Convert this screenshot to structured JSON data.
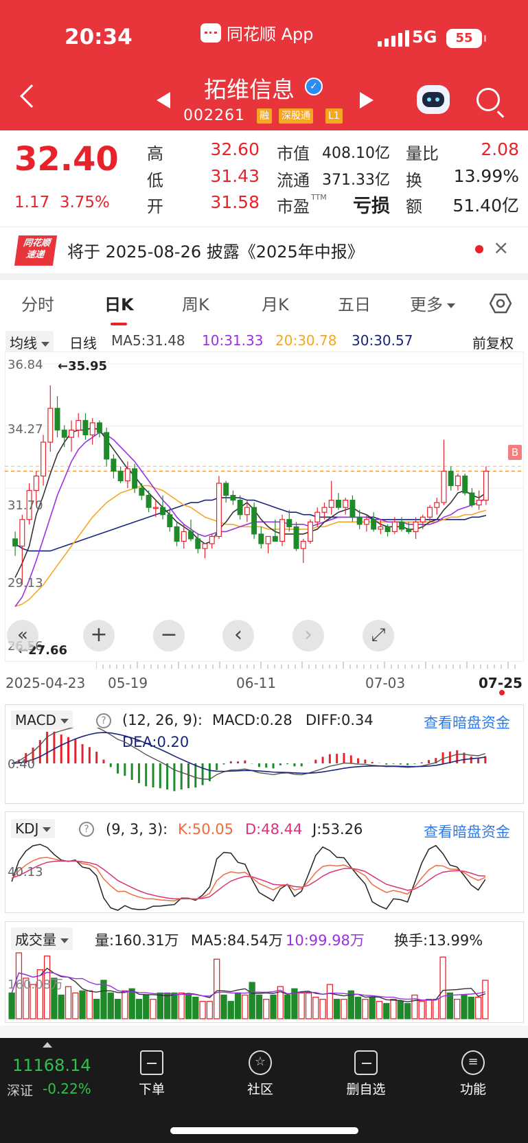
{
  "status_bar": {
    "time": "20:34",
    "app_name": "同花顺 App",
    "network": "5G",
    "battery": "55"
  },
  "header": {
    "stock_name": "拓维信息",
    "stock_code": "002261",
    "badges": [
      "融",
      "深股通",
      "L1"
    ]
  },
  "quote": {
    "price": "32.40",
    "change": "1.17",
    "change_pct": "3.75%",
    "high_label": "高",
    "high": "32.60",
    "low_label": "低",
    "low": "31.43",
    "open_label": "开",
    "open": "31.58",
    "mktcap_label": "市值",
    "mktcap": "408.10亿",
    "float_label": "流通",
    "float": "371.33亿",
    "pe_label": "市盈",
    "pe_sup": "TTM",
    "pe": "亏损",
    "vol_ratio_label": "量比",
    "vol_ratio": "2.08",
    "turnover_label": "换",
    "turnover": "13.99%",
    "amount_label": "额",
    "amount": "51.40亿"
  },
  "notice": {
    "logo_line1": "同花顺",
    "logo_line2": "速递",
    "text": "将于 2025-08-26 披露《2025年中报》",
    "close": "×"
  },
  "tabs": [
    "分时",
    "日K",
    "周K",
    "月K",
    "五日",
    "更多"
  ],
  "ma_bar": {
    "selector": "均线",
    "kline_label": "日线",
    "ma5": "MA5:31.48",
    "ma10": "10:31.33",
    "ma20": "20:30.78",
    "ma30": "30:30.57",
    "adjust": "前复权"
  },
  "colors": {
    "up": "#e8222a",
    "down": "#1f8a2a",
    "ma5": "#333333",
    "ma10": "#9b30e0",
    "ma20": "#f5a623",
    "ma30": "#1a237e"
  },
  "kline": {
    "y_axis": [
      "36.84",
      "34.27",
      "31.70",
      "29.13",
      "26.56"
    ],
    "max_label": "←35.95",
    "min_label": "←27.66",
    "b_marker": "B",
    "dates": [
      "2025-04-23",
      "05-19",
      "06-11",
      "07-03",
      "07-25"
    ],
    "zoom_plus": "+",
    "zoom_minus": "−",
    "nav_prev": "‹",
    "nav_next": "›",
    "fullscreen": "⤢",
    "collapse": "«"
  },
  "chart_data": {
    "type": "candlestick",
    "ylim": [
      26.56,
      36.84
    ],
    "candles": [
      [
        29.6,
        29.9,
        28.9,
        29.3
      ],
      [
        29.3,
        30.6,
        27.7,
        30.4
      ],
      [
        30.4,
        31.9,
        30.2,
        31.6
      ],
      [
        31.6,
        32.4,
        31.0,
        32.2
      ],
      [
        32.2,
        33.9,
        31.8,
        33.6
      ],
      [
        33.6,
        35.95,
        33.2,
        35.0
      ],
      [
        35.0,
        35.5,
        33.8,
        34.1
      ],
      [
        34.1,
        34.3,
        33.4,
        33.8
      ],
      [
        33.8,
        34.5,
        33.2,
        34.1
      ],
      [
        34.1,
        34.8,
        33.8,
        34.5
      ],
      [
        34.5,
        34.8,
        33.7,
        33.9
      ],
      [
        33.9,
        34.6,
        33.5,
        34.4
      ],
      [
        34.4,
        34.5,
        33.8,
        34.0
      ],
      [
        34.0,
        34.2,
        32.6,
        32.9
      ],
      [
        32.9,
        33.1,
        32.1,
        32.4
      ],
      [
        32.4,
        32.6,
        31.9,
        32.0
      ],
      [
        32.0,
        32.8,
        31.7,
        32.5
      ],
      [
        32.5,
        32.7,
        31.5,
        31.7
      ],
      [
        31.7,
        31.9,
        31.2,
        31.4
      ],
      [
        31.4,
        31.6,
        30.7,
        30.9
      ],
      [
        30.9,
        31.2,
        30.5,
        30.9
      ],
      [
        30.9,
        31.4,
        30.4,
        30.6
      ],
      [
        30.6,
        30.9,
        29.9,
        30.1
      ],
      [
        30.1,
        30.3,
        29.3,
        29.5
      ],
      [
        29.5,
        30.2,
        29.2,
        29.9
      ],
      [
        29.9,
        30.4,
        29.5,
        29.6
      ],
      [
        29.6,
        29.8,
        29.0,
        29.2
      ],
      [
        29.2,
        29.4,
        28.8,
        29.4
      ],
      [
        29.4,
        29.8,
        29.2,
        29.7
      ],
      [
        29.7,
        32.2,
        29.6,
        31.9
      ],
      [
        31.9,
        32.0,
        31.1,
        31.4
      ],
      [
        31.4,
        31.6,
        31.0,
        31.2
      ],
      [
        31.2,
        31.4,
        30.4,
        30.6
      ],
      [
        30.6,
        31.2,
        30.3,
        30.9
      ],
      [
        30.9,
        31.1,
        29.6,
        29.8
      ],
      [
        29.8,
        30.1,
        29.2,
        29.4
      ],
      [
        29.4,
        29.7,
        29.0,
        29.7
      ],
      [
        29.7,
        30.4,
        29.5,
        29.5
      ],
      [
        29.5,
        30.6,
        29.3,
        30.4
      ],
      [
        30.4,
        30.8,
        29.9,
        30.1
      ],
      [
        30.1,
        30.3,
        29.1,
        29.2
      ],
      [
        29.2,
        29.6,
        28.6,
        29.5
      ],
      [
        29.5,
        30.4,
        29.4,
        30.3
      ],
      [
        30.3,
        30.9,
        30.1,
        30.7
      ],
      [
        30.7,
        31.1,
        30.4,
        30.9
      ],
      [
        30.9,
        32.0,
        30.6,
        31.2
      ],
      [
        31.2,
        31.5,
        30.8,
        30.9
      ],
      [
        30.9,
        31.3,
        30.6,
        31.2
      ],
      [
        31.2,
        31.4,
        30.3,
        30.5
      ],
      [
        30.5,
        30.8,
        30.0,
        30.2
      ],
      [
        30.2,
        30.6,
        29.9,
        30.4
      ],
      [
        30.4,
        30.7,
        29.9,
        30.0
      ],
      [
        30.0,
        30.4,
        29.8,
        30.1
      ],
      [
        30.1,
        30.2,
        29.7,
        29.9
      ],
      [
        29.9,
        30.5,
        29.8,
        30.3
      ],
      [
        30.3,
        30.5,
        29.9,
        30.0
      ],
      [
        30.0,
        30.3,
        29.8,
        29.9
      ],
      [
        29.9,
        30.5,
        29.6,
        30.3
      ],
      [
        30.3,
        30.6,
        30.0,
        30.5
      ],
      [
        30.5,
        31.0,
        30.3,
        30.9
      ],
      [
        30.9,
        31.3,
        30.6,
        31.1
      ],
      [
        31.1,
        33.7,
        31.0,
        32.4
      ],
      [
        32.4,
        32.6,
        31.6,
        31.8
      ],
      [
        31.8,
        32.3,
        31.6,
        32.2
      ],
      [
        32.2,
        32.3,
        31.4,
        31.5
      ],
      [
        31.5,
        31.7,
        30.9,
        31.0
      ],
      [
        31.0,
        31.6,
        30.8,
        31.2
      ],
      [
        31.2,
        32.6,
        31.0,
        32.4
      ]
    ],
    "ma5": [
      28.0,
      28.6,
      29.3,
      30.6,
      31.4,
      32.3,
      33.1,
      33.6,
      34.0,
      34.1,
      34.1,
      34.2,
      34.1,
      33.7,
      33.3,
      32.9,
      32.5,
      32.2,
      31.8,
      31.5,
      31.2,
      30.9,
      30.6,
      30.3,
      30.1,
      29.9,
      29.6,
      29.4,
      29.5,
      30.0,
      30.3,
      30.7,
      30.9,
      31.1,
      30.8,
      30.4,
      30.1,
      29.9,
      29.8,
      29.8,
      29.8,
      29.8,
      29.9,
      30.0,
      30.3,
      30.5,
      30.7,
      30.8,
      30.9,
      30.7,
      30.6,
      30.4,
      30.2,
      30.1,
      30.1,
      30.1,
      30.0,
      30.0,
      30.1,
      30.3,
      30.4,
      30.8,
      31.1,
      31.5,
      31.6,
      31.4,
      31.3,
      31.5
    ],
    "ma10": [
      26.8,
      27.2,
      27.9,
      28.7,
      29.6,
      30.5,
      31.4,
      32.1,
      32.8,
      33.3,
      33.6,
      33.8,
      34.0,
      33.9,
      33.7,
      33.4,
      33.1,
      32.8,
      32.4,
      32.0,
      31.6,
      31.2,
      30.9,
      30.5,
      30.2,
      30.0,
      29.8,
      29.7,
      29.8,
      29.9,
      29.9,
      30.0,
      30.1,
      30.2,
      30.3,
      30.3,
      30.3,
      30.3,
      30.3,
      30.2,
      30.2,
      30.2,
      30.1,
      30.2,
      30.3,
      30.4,
      30.5,
      30.5,
      30.5,
      30.5,
      30.5,
      30.4,
      30.4,
      30.3,
      30.3,
      30.3,
      30.2,
      30.2,
      30.2,
      30.2,
      30.3,
      30.5,
      30.6,
      30.8,
      30.9,
      31.0,
      31.1,
      31.3
    ],
    "ma20": [
      26.8,
      26.9,
      27.1,
      27.4,
      27.7,
      28.1,
      28.5,
      28.9,
      29.3,
      29.7,
      30.1,
      30.5,
      30.8,
      31.1,
      31.3,
      31.5,
      31.6,
      31.7,
      31.8,
      31.8,
      31.7,
      31.6,
      31.4,
      31.2,
      31.0,
      30.9,
      30.7,
      30.5,
      30.4,
      30.3,
      30.2,
      30.2,
      30.1,
      30.1,
      30.1,
      30.1,
      30.0,
      30.0,
      30.0,
      30.0,
      30.0,
      30.0,
      30.0,
      30.1,
      30.1,
      30.2,
      30.3,
      30.3,
      30.3,
      30.3,
      30.3,
      30.3,
      30.3,
      30.3,
      30.3,
      30.3,
      30.3,
      30.3,
      30.3,
      30.3,
      30.3,
      30.4,
      30.5,
      30.5,
      30.6,
      30.6,
      30.7,
      30.78
    ],
    "ma30": [
      29.4,
      29.2,
      29.1,
      29.1,
      29.1,
      29.1,
      29.2,
      29.3,
      29.4,
      29.5,
      29.6,
      29.7,
      29.8,
      29.9,
      30.0,
      30.1,
      30.2,
      30.3,
      30.4,
      30.5,
      30.6,
      30.7,
      30.8,
      30.9,
      31.0,
      31.1,
      31.1,
      31.2,
      31.2,
      31.3,
      31.3,
      31.3,
      31.3,
      31.2,
      31.2,
      31.1,
      31.0,
      30.9,
      30.8,
      30.7,
      30.7,
      30.6,
      30.6,
      30.5,
      30.5,
      30.5,
      30.5,
      30.5,
      30.5,
      30.5,
      30.5,
      30.5,
      30.4,
      30.4,
      30.4,
      30.4,
      30.4,
      30.4,
      30.4,
      30.4,
      30.4,
      30.4,
      30.4,
      30.4,
      30.4,
      30.5,
      30.5,
      30.57
    ]
  },
  "macd": {
    "selector": "MACD",
    "help": "?",
    "params": "(12, 26, 9):",
    "macd": "MACD:0.28",
    "diff": "DIFF:0.34",
    "dea": "DEA:0.20",
    "link": "查看暗盘资金",
    "axis": "0.40"
  },
  "kdj": {
    "selector": "KDJ",
    "help": "?",
    "params": "(9, 3, 3):",
    "k": "K:50.05",
    "d": "D:48.44",
    "j": "J:53.26",
    "link": "查看暗盘资金",
    "axis": "40.13"
  },
  "volume": {
    "selector": "成交量",
    "vol": "量:160.31万",
    "ma5": "MA5:84.54万",
    "ma10": "10:99.98万",
    "turnover": "换手:13.99%",
    "axis": "160.08万"
  },
  "bottom_bar": {
    "index_value": "11168.14",
    "index_name": "深证",
    "index_change": "-0.22%",
    "items": [
      "下单",
      "社区",
      "删自选",
      "功能"
    ]
  }
}
